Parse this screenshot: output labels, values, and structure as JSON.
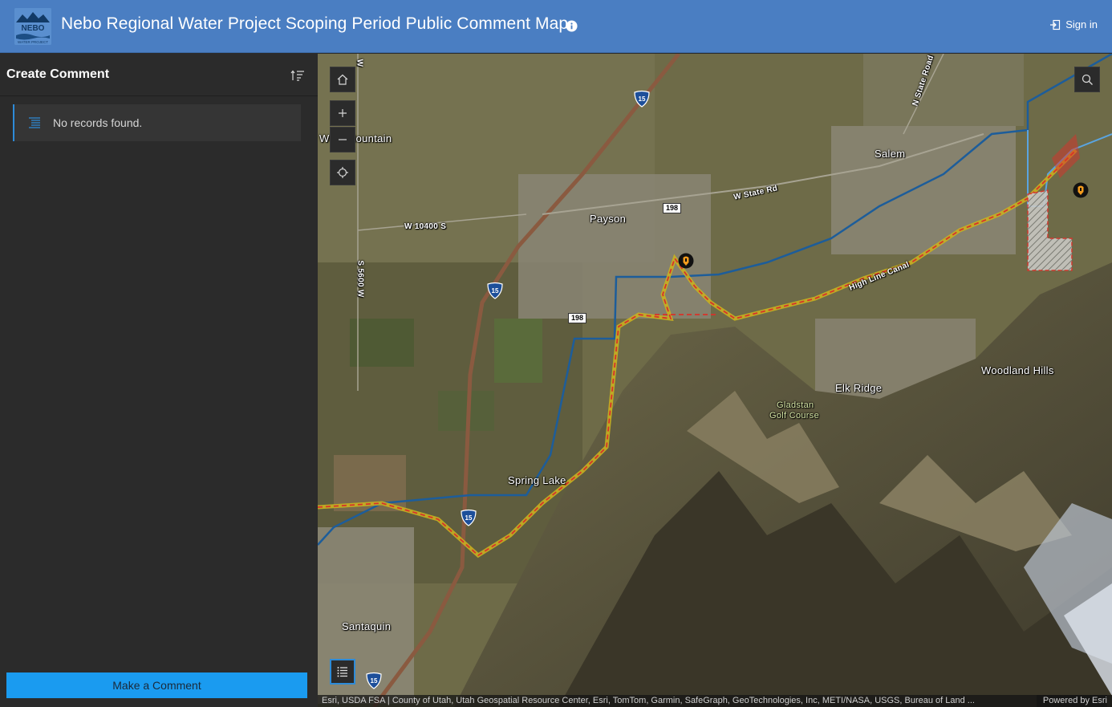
{
  "header": {
    "title": "Nebo Regional Water Project Scoping Period Public Comment Map",
    "logo_text": "NEBO",
    "logo_subtext": "WATER PROJECT",
    "signin_label": "Sign in",
    "bg_color": "#4a7ec2"
  },
  "panel": {
    "title": "Create Comment",
    "empty_message": "No records found.",
    "make_comment_label": "Make a Comment",
    "accent_color": "#1a9bf0"
  },
  "map": {
    "place_labels": {
      "payson": "Payson",
      "salem": "Salem",
      "elk_ridge": "Elk Ridge",
      "woodland_hills": "Woodland Hills",
      "spring_lake": "Spring Lake",
      "santaquin": "Santaquin",
      "west_mountain": "West Mountain",
      "gladstan": "Gladstan",
      "golf_course": "Golf Course"
    },
    "road_labels": {
      "w_state_rd": "W State Rd",
      "n_state_road": "N State Road",
      "w_10400_s": "W 10400 S",
      "s_5600_w": "S 5600 W",
      "w_road_vertical": "W",
      "high_line_canal": "High Line Canal"
    },
    "route_shields": {
      "i15": "15",
      "sr198": "198"
    },
    "attribution": "Esri, USDA FSA | County of Utah, Utah Geospatial Resource Center, Esri, TomTom, Garmin, SafeGraph, GeoTechnologies, Inc, METI/NASA, USGS, Bureau of Land ...",
    "powered_by": "Powered by Esri",
    "controls": [
      "home-icon",
      "zoom-in-icon",
      "zoom-out-icon",
      "locate-icon",
      "search-icon",
      "legend-icon"
    ]
  }
}
